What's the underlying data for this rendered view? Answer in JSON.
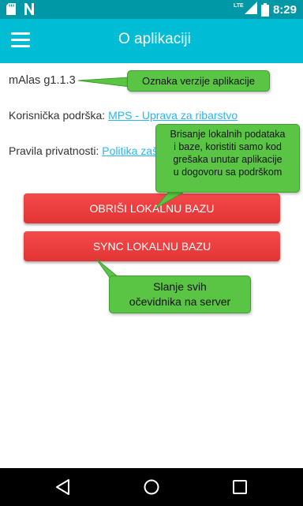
{
  "status_bar": {
    "network": "LTE",
    "time": "8:29",
    "icons": [
      "sd-card-icon",
      "n-notification-icon",
      "signal-icon",
      "battery-icon"
    ]
  },
  "app_bar": {
    "title": "O aplikaciji",
    "menu_icon": "hamburger-menu-icon"
  },
  "content": {
    "version": "mAlas g1.1.3",
    "support_label": "Korisnička podrška:",
    "support_link": "MPS - Uprava za ribarstvo",
    "privacy_label": "Pravila privatnosti:",
    "privacy_link": "Politika zaš"
  },
  "buttons": {
    "delete_db": "OBRIŠI LOKALNU BAZU",
    "sync_db": "SYNC LOKALNU BAZU"
  },
  "callouts": {
    "version_note": "Oznaka verzije aplikacije",
    "delete_note": [
      "Brisanje lokalnih podataka",
      "i baze, koristiti samo kod",
      "grešaka unutar aplikacije",
      "u dogovoru sa podrškom"
    ],
    "sync_note": [
      "Slanje svih",
      "očevidnika na server"
    ]
  },
  "colors": {
    "status_bar": "#0097a7",
    "app_bar": "#00bcd4",
    "button": "#e53935",
    "link": "#29b6f6",
    "callout": "#5ac544"
  },
  "nav_bar": {
    "icons": [
      "back-triangle-icon",
      "home-circle-icon",
      "recents-square-icon"
    ]
  }
}
